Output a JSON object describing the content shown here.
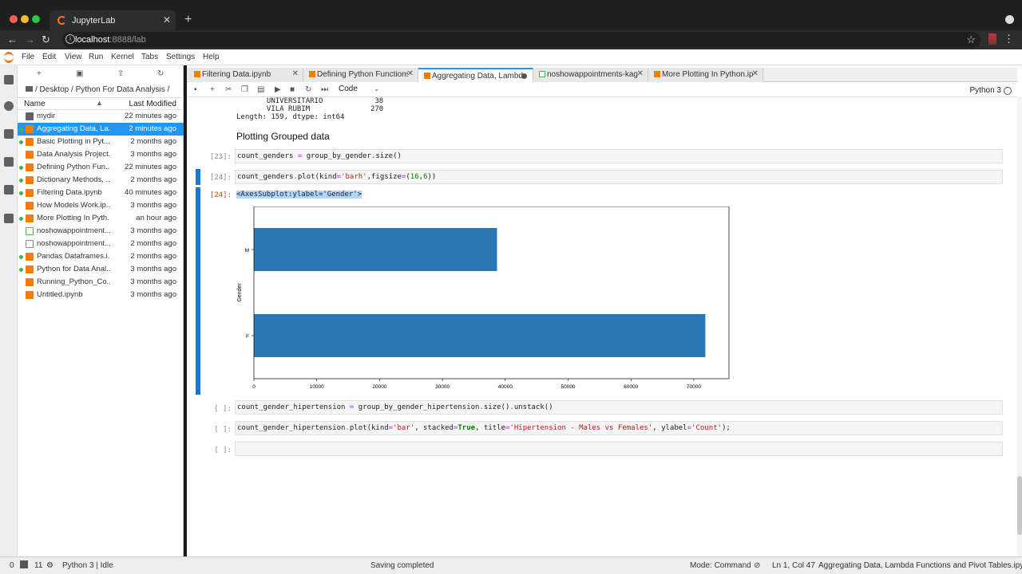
{
  "browser": {
    "tab_title": "JupyterLab",
    "url_host": "localhost",
    "url_path": ":8888/lab"
  },
  "menubar": [
    "File",
    "Edit",
    "View",
    "Run",
    "Kernel",
    "Tabs",
    "Settings",
    "Help"
  ],
  "filebrowser": {
    "breadcrumb": "/ Desktop / Python For Data Analysis /",
    "col_name": "Name",
    "col_modified": "Last Modified",
    "files": [
      {
        "name": "mydir",
        "modified": "22 minutes ago",
        "type": "folder",
        "running": false,
        "selected": false
      },
      {
        "name": "Aggregating Data, La...",
        "modified": "2 minutes ago",
        "type": "notebook",
        "running": true,
        "selected": true
      },
      {
        "name": "Basic Plotting in Pyt...",
        "modified": "2 months ago",
        "type": "notebook",
        "running": true,
        "selected": false
      },
      {
        "name": "Data Analysis Project...",
        "modified": "3 months ago",
        "type": "notebook",
        "running": false,
        "selected": false
      },
      {
        "name": "Defining Python Fun...",
        "modified": "22 minutes ago",
        "type": "notebook",
        "running": true,
        "selected": false
      },
      {
        "name": "Dictionary Methods, ...",
        "modified": "2 months ago",
        "type": "notebook",
        "running": true,
        "selected": false
      },
      {
        "name": "Filtering Data.ipynb",
        "modified": "40 minutes ago",
        "type": "notebook",
        "running": true,
        "selected": false
      },
      {
        "name": "How Models Work.ip...",
        "modified": "3 months ago",
        "type": "notebook",
        "running": false,
        "selected": false
      },
      {
        "name": "More Plotting In Pyth...",
        "modified": "an hour ago",
        "type": "notebook",
        "running": true,
        "selected": false
      },
      {
        "name": "noshowappointment...",
        "modified": "3 months ago",
        "type": "csv",
        "running": false,
        "selected": false
      },
      {
        "name": "noshowappointment...",
        "modified": "2 months ago",
        "type": "file",
        "running": false,
        "selected": false
      },
      {
        "name": "Pandas Dataframes.i...",
        "modified": "2 months ago",
        "type": "notebook",
        "running": true,
        "selected": false
      },
      {
        "name": "Python for Data Anal...",
        "modified": "3 months ago",
        "type": "notebook",
        "running": true,
        "selected": false
      },
      {
        "name": "Running_Python_Co...",
        "modified": "3 months ago",
        "type": "notebook",
        "running": false,
        "selected": false
      },
      {
        "name": "Untitled.ipynb",
        "modified": "3 months ago",
        "type": "notebook",
        "running": false,
        "selected": false
      }
    ]
  },
  "doc_tabs": [
    {
      "title": "Filtering Data.ipynb",
      "type": "notebook",
      "active": false,
      "dirty": false
    },
    {
      "title": "Defining Python Functions.",
      "type": "notebook",
      "active": false,
      "dirty": false
    },
    {
      "title": "Aggregating Data, Lambda",
      "type": "notebook",
      "active": true,
      "dirty": true
    },
    {
      "title": "noshowappointments-kagg",
      "type": "csv",
      "active": false,
      "dirty": false
    },
    {
      "title": "More Plotting In Python.ipy",
      "type": "notebook",
      "active": false,
      "dirty": false
    }
  ],
  "toolbar": {
    "cell_type": "Code",
    "kernel": "Python 3"
  },
  "notebook": {
    "prev_output": "       UNIVERSITÁRIO            38\n       VILA RUBIM              270\nLength: 159, dtype: int64",
    "heading": "Plotting Grouped data",
    "cells": [
      {
        "prompt": "[23]:",
        "code_html": "count_genders <span class=\"o\">=</span> group_by_gender<span class=\"o\">.</span>size()"
      },
      {
        "prompt": "[24]:",
        "code_html": "count_genders<span class=\"o\">.</span>plot(kind<span class=\"o\">=</span><span class=\"s\">'barh'</span>,figsize<span class=\"o\">=</span>(<span class=\"k\" style=\"font-weight:normal;color:#008000\">16</span>,<span class=\"k\" style=\"font-weight:normal;color:#008000\">6</span>))"
      },
      {
        "prompt": "[ ]:",
        "code_html": "count_gender_hipertension <span class=\"o\">=</span> group_by_gender_hipertension<span class=\"o\">.</span>size()<span class=\"o\">.</span>unstack()"
      },
      {
        "prompt": "[ ]:",
        "code_html": "count_gender_hipertension<span class=\"o\">.</span>plot(kind<span class=\"o\">=</span><span class=\"s\">'bar'</span>, stacked<span class=\"o\">=</span><span class=\"k\">True</span>, title<span class=\"o\">=</span><span class=\"s\">'Hipertension - Males vs Females'</span>, ylabel<span class=\"o\">=</span><span class=\"s\">'Count'</span>);"
      },
      {
        "prompt": "[ ]:",
        "code_html": ""
      }
    ],
    "out_prompt": "[24]:",
    "out_text": "<AxesSubplot:ylabel='Gender'>"
  },
  "chart_data": {
    "type": "bar",
    "orientation": "horizontal",
    "categories": [
      "M",
      "F"
    ],
    "values": [
      38687,
      71840
    ],
    "ylabel": "Gender",
    "xlabel": "",
    "xlim": [
      0,
      75600
    ],
    "xticks": [
      0,
      10000,
      20000,
      30000,
      40000,
      50000,
      60000,
      70000
    ],
    "bar_color": "#2a77b4",
    "grid": false
  },
  "statusbar": {
    "zero": "0",
    "terminals": "11",
    "kernel_status": "Python 3 | Idle",
    "message": "Saving completed",
    "mode": "Mode: Command",
    "cursor": "Ln 1, Col 47",
    "filename": "Aggregating Data, Lambda Functions and Pivot Tables.ipynb"
  }
}
